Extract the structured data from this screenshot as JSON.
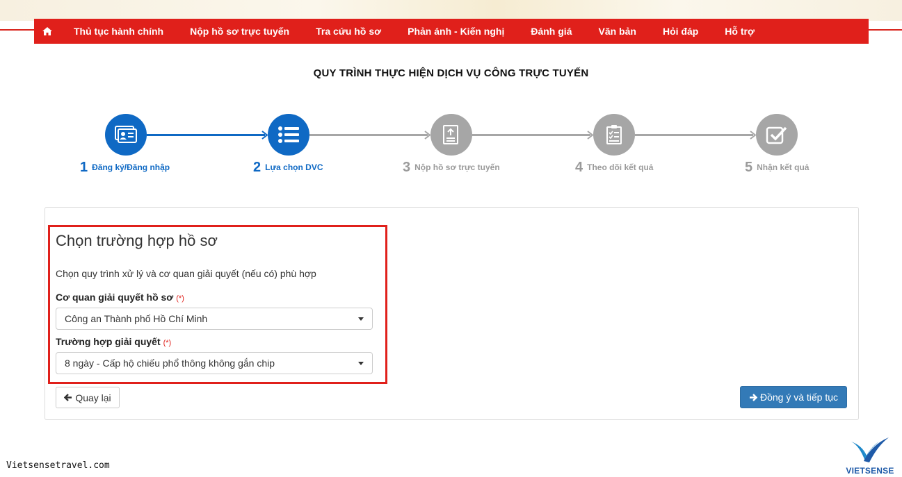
{
  "nav": {
    "home_icon": "home-icon",
    "items": [
      "Thủ tục hành chính",
      "Nộp hồ sơ trực tuyến",
      "Tra cứu hồ sơ",
      "Phản ánh - Kiến nghị",
      "Đánh giá",
      "Văn bản",
      "Hỏi đáp",
      "Hỗ trợ"
    ]
  },
  "page_title": "QUY TRÌNH THỰC HIỆN DỊCH VỤ CÔNG TRỰC TUYẾN",
  "steps": [
    {
      "num": "1",
      "label": "Đăng ký/Đăng nhập",
      "icon": "id-card-icon",
      "state": "active"
    },
    {
      "num": "2",
      "label": "Lựa chọn DVC",
      "icon": "list-icon",
      "state": "active"
    },
    {
      "num": "3",
      "label": "Nộp hồ sơ trực tuyến",
      "icon": "file-upload-icon",
      "state": "inactive"
    },
    {
      "num": "4",
      "label": "Theo dõi kết quả",
      "icon": "clipboard-list-icon",
      "state": "inactive"
    },
    {
      "num": "5",
      "label": "Nhận kết quả",
      "icon": "check-square-icon",
      "state": "inactive"
    }
  ],
  "form": {
    "title": "Chọn trường hợp hồ sơ",
    "description": "Chọn quy trình xử lý và cơ quan giải quyết (nếu có) phù hợp",
    "agency_label": "Cơ quan giải quyết hồ sơ",
    "agency_required": "(*)",
    "agency_value": "Công an Thành phố Hồ Chí Minh",
    "case_label": "Trường hợp giải quyết",
    "case_required": "(*)",
    "case_value": "8 ngày - Cấp hộ chiếu phổ thông không gắn chip"
  },
  "buttons": {
    "back": "Quay lại",
    "next": "Đồng ý và tiếp tục"
  },
  "watermark": "Vietsensetravel.com",
  "logo_text": "VIETSENSE",
  "colors": {
    "nav_red": "#e0201b",
    "step_active": "#0f69c4",
    "step_inactive": "#a6a6a6",
    "primary_button": "#337ab7",
    "highlight_box": "#e0201b"
  }
}
